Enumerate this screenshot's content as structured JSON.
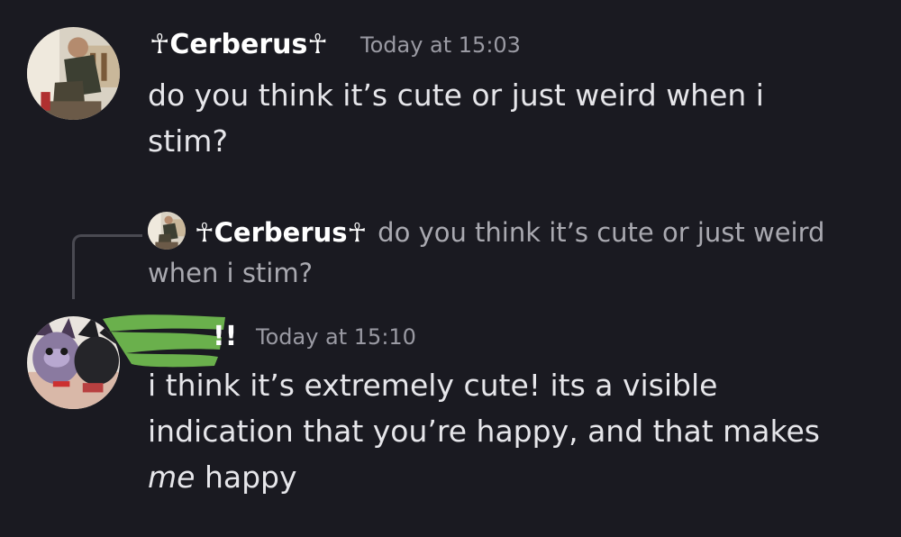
{
  "messages": [
    {
      "username": "☥Cerberus☥",
      "timestamp": "Today at 15:03",
      "content": "do you think it’s cute or just weird when i stim?"
    },
    {
      "username": "!!",
      "timestamp": "Today at 15:10",
      "content_main": "i think it’s extremely cute! its a visible indication that you’re happy, and that makes ",
      "content_emphasis": "me",
      "content_tail": " happy"
    }
  ],
  "reply": {
    "username": "☥Cerberus☥",
    "content": "do you think it’s cute or just weird when i stim?"
  },
  "colors": {
    "background": "#1a1a21",
    "username": "#ffffff",
    "timestamp": "#9a9aa3",
    "redaction": "#6ab04c"
  }
}
